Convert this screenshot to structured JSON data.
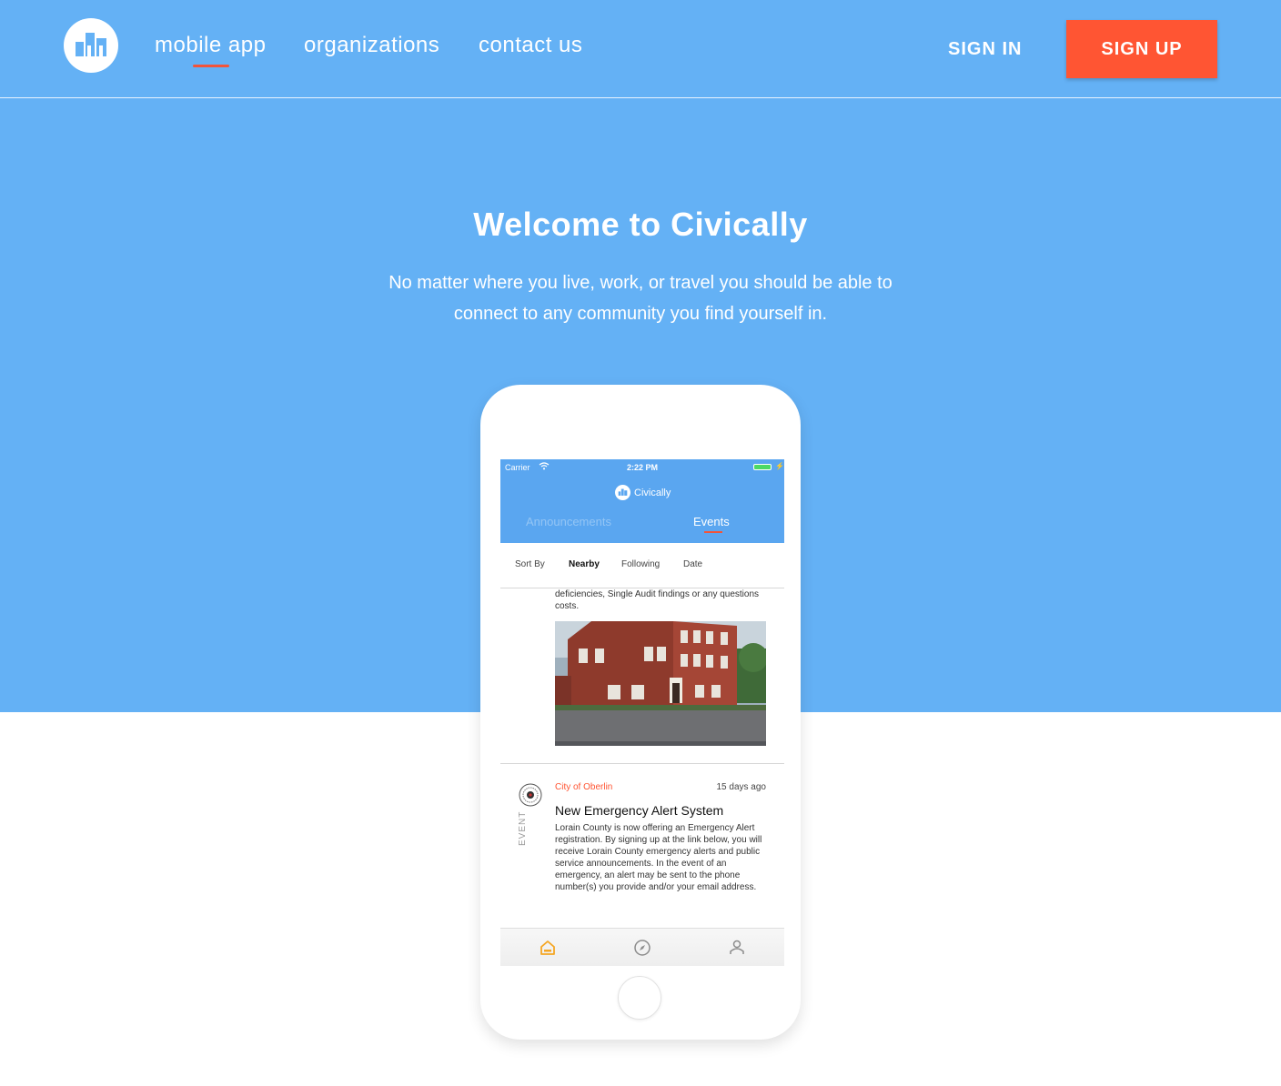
{
  "nav": {
    "links": [
      {
        "label": "mobile app",
        "active": true
      },
      {
        "label": "organizations"
      },
      {
        "label": "contact us"
      }
    ],
    "sign_in": "SIGN IN",
    "sign_up": "SIGN UP"
  },
  "hero": {
    "title": "Welcome to Civically",
    "subtitle": "No matter where you live, work, or travel you should be able to connect to any community you find yourself in."
  },
  "phone": {
    "status": {
      "carrier": "Carrier",
      "time": "2:22 PM"
    },
    "app_name": "Civically",
    "tabs": {
      "announcements": "Announcements",
      "events": "Events"
    },
    "sort": {
      "label": "Sort By",
      "options": [
        "Nearby",
        "Following",
        "Date"
      ],
      "selected": "Nearby"
    },
    "feed": {
      "partial_text": "deficiencies, Single Audit findings or any questions costs.",
      "item": {
        "org": "City of Oberlin",
        "age": "15 days ago",
        "kind": "EVENT",
        "title": "New Emergency Alert System",
        "body": "Lorain County is now offering an Emergency Alert registration. By signing up at the link below, you will receive Lorain County emergency alerts and public service announcements. In the event of an emergency, an alert may be sent to the phone number(s) you provide and/or your email address."
      }
    },
    "tabbar": [
      "home-icon",
      "compass-icon",
      "user-icon"
    ]
  },
  "colors": {
    "hero": "#64b1f5",
    "accent": "#ff5533",
    "app_header": "#5aa6f0"
  }
}
